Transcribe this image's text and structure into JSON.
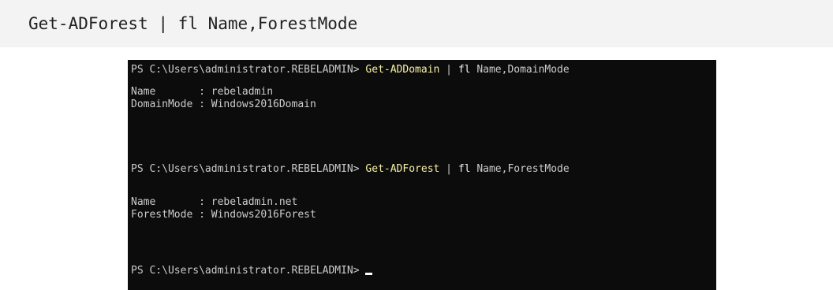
{
  "snippet": {
    "command": "Get-ADForest | fl Name,ForestMode"
  },
  "console": {
    "line1": {
      "prompt": "PS C:\\Users\\administrator.REBELADMIN>",
      "cmdlet": "Get-ADDomain",
      "pipe": "|",
      "fl": "fl",
      "args": "Name,DomainMode"
    },
    "output1": [
      {
        "key": "Name      ",
        "sep": " : ",
        "value": "rebeladmin"
      },
      {
        "key": "DomainMode",
        "sep": " : ",
        "value": "Windows2016Domain"
      }
    ],
    "line2": {
      "prompt": "PS C:\\Users\\administrator.REBELADMIN>",
      "cmdlet": "Get-ADForest",
      "pipe": "|",
      "fl": "fl",
      "args": "Name,ForestMode"
    },
    "output2": [
      {
        "key": "Name      ",
        "sep": " : ",
        "value": "rebeladmin.net"
      },
      {
        "key": "ForestMode",
        "sep": " : ",
        "value": "Windows2016Forest"
      }
    ],
    "final_prompt": "PS C:\\Users\\administrator.REBELADMIN>"
  },
  "colors": {
    "background": "#0c0c0c",
    "text": "#cccccc",
    "cmdlet": "#f9f1a5",
    "snippet_bg": "#f3f3f3"
  }
}
